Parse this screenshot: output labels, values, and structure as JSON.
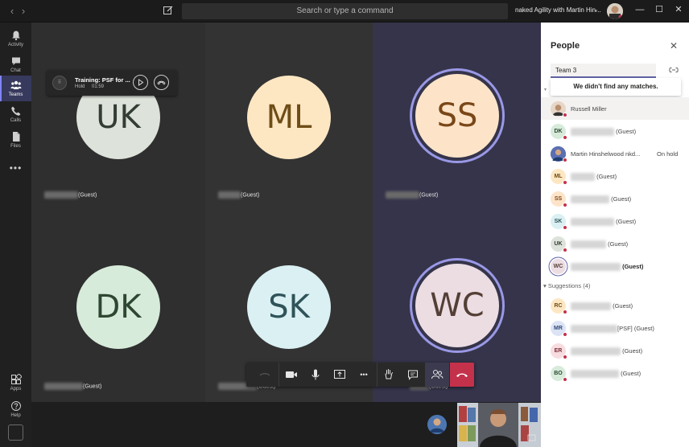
{
  "titlebar": {
    "search_placeholder": "Search or type a command",
    "meeting_title": "naked Agility with Martin Hin...",
    "chevron": "⌄",
    "back_icon": "chevron-left-icon",
    "forward_icon": "chevron-right-icon",
    "minimize": "—",
    "maximize": "☐",
    "close": "✕"
  },
  "rail": {
    "items": [
      {
        "label": "Activity",
        "icon": "bell-icon"
      },
      {
        "label": "Chat",
        "icon": "chat-icon"
      },
      {
        "label": "Teams",
        "icon": "teams-icon",
        "active": true
      },
      {
        "label": "Calls",
        "icon": "phone-icon"
      },
      {
        "label": "Files",
        "icon": "file-icon"
      }
    ],
    "more": "•••",
    "bottom": [
      {
        "label": "Apps",
        "icon": "apps-icon"
      },
      {
        "label": "Help",
        "icon": "help-icon"
      }
    ]
  },
  "hold_banner": {
    "title": "Training: PSF for ...",
    "status": "Hold",
    "time": "01:59"
  },
  "tiles": [
    {
      "initials": "UK",
      "suffix": "(Guest)",
      "bg": "#dde3da",
      "fg": "#333d35"
    },
    {
      "initials": "ML",
      "suffix": "(Guest)",
      "bg": "#fde7c3",
      "fg": "#6e4d17"
    },
    {
      "initials": "SS",
      "suffix": "(Guest)",
      "bg": "#fde4c9",
      "fg": "#7a4718",
      "ring": true
    },
    {
      "initials": "DK",
      "suffix": "(Guest)",
      "bg": "#d7ebdb",
      "fg": "#2e4732"
    },
    {
      "initials": "SK",
      "suffix": "(Guest)",
      "bg": "#daf0f3",
      "fg": "#2f5358"
    },
    {
      "initials": "WC",
      "suffix": "(Guest)",
      "bg": "#ecdde3",
      "fg": "#533f35",
      "ring": true
    }
  ],
  "controls": {
    "items": [
      "dial-pad-icon",
      "video-icon",
      "mic-icon",
      "share-screen-icon",
      "more-icon",
      "raise-hand-icon",
      "chat-icon",
      "people-icon",
      "hang-up-icon"
    ],
    "more_glyph": "•••"
  },
  "people_panel": {
    "title": "People",
    "search_value": "Team 3",
    "no_match": "We didn't find any matches.",
    "participants": [
      {
        "initials": "",
        "name": "Russell Miller",
        "suffix": "",
        "photo": true,
        "highlight": true,
        "bg": "#e7d6c6"
      },
      {
        "initials": "DK",
        "name": "",
        "suffix": "(Guest)",
        "bg": "#d7ebdb",
        "fg": "#2e4732"
      },
      {
        "initials": "",
        "name": "Martin Hinshelwood nkd...",
        "suffix": "",
        "status": "On hold",
        "photo": true,
        "bg": "#5b6fb1"
      },
      {
        "initials": "ML",
        "name": "",
        "suffix": "(Guest)",
        "bg": "#fde7c3",
        "fg": "#6e4d17"
      },
      {
        "initials": "SS",
        "name": "",
        "suffix": "(Guest)",
        "bg": "#fde4c9",
        "fg": "#7a4718"
      },
      {
        "initials": "SK",
        "name": "",
        "suffix": "(Guest)",
        "bg": "#daf0f3",
        "fg": "#2f5358"
      },
      {
        "initials": "UK",
        "name": "",
        "suffix": "(Guest)",
        "bg": "#dde3da",
        "fg": "#333d35"
      },
      {
        "initials": "WC",
        "name": "",
        "suffix": "(Guest)",
        "bg": "#ecdde3",
        "fg": "#533f35",
        "bold": true,
        "ring": true
      }
    ],
    "suggestions_label": "Suggestions (4)",
    "suggestions": [
      {
        "initials": "RC",
        "suffix": "(Guest)",
        "bg": "#fde7c3",
        "fg": "#6e4d17"
      },
      {
        "initials": "MR",
        "suffix": "[PSF] (Guest)",
        "bg": "#dbe3f5",
        "fg": "#354a7a"
      },
      {
        "initials": "ER",
        "suffix": "(Guest)",
        "bg": "#f7dde0",
        "fg": "#7a2d37"
      },
      {
        "initials": "BO",
        "suffix": "(Guest)",
        "bg": "#d7ebdb",
        "fg": "#2e4732"
      }
    ]
  },
  "colors": {
    "accent": "#6264a7",
    "hangup": "#c4314b",
    "ring": "#9a98e6",
    "presence_busy": "#c4314b"
  }
}
